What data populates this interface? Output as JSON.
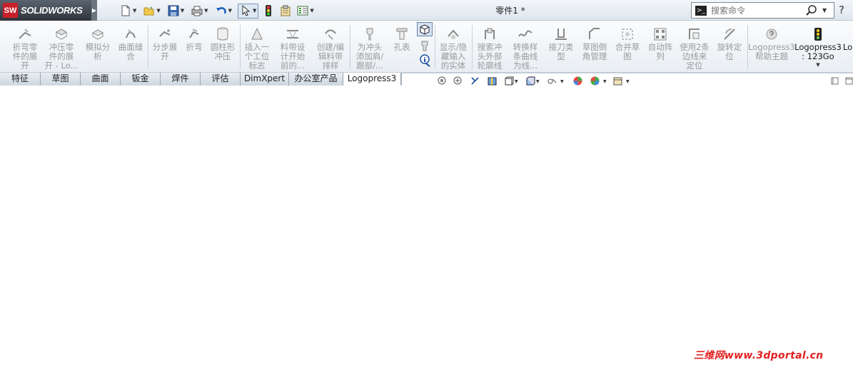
{
  "app": {
    "logo_mark": "SW",
    "logo_text": "SOLIDWORKS",
    "doc_title": "零件1 *"
  },
  "quick_access": [
    {
      "name": "new-document-icon"
    },
    {
      "name": "open-folder-icon"
    },
    {
      "name": "save-icon"
    },
    {
      "name": "print-icon"
    },
    {
      "name": "undo-icon"
    },
    {
      "name": "select-arrow-icon"
    },
    {
      "name": "rebuild-traffic-light-icon"
    },
    {
      "name": "file-properties-icon"
    },
    {
      "name": "options-icon"
    }
  ],
  "search": {
    "placeholder": "搜索命令",
    "help_glyph": "?"
  },
  "ribbon": {
    "tools": [
      {
        "label": "折弯零\n件的展\n开",
        "icon": "bend-unfold-icon"
      },
      {
        "label": "冲压零\n件的展\n开 - Lo...",
        "icon": "stamp-unfold-icon"
      },
      {
        "label": "模拟分\n析",
        "icon": "simulation-icon"
      },
      {
        "label": "曲面缝\n合",
        "icon": "surface-knit-icon"
      },
      {
        "label": "分步展\n开",
        "icon": "step-unfold-icon"
      },
      {
        "label": "折弯",
        "icon": "bend-icon"
      },
      {
        "label": "圆柱形\n冲压",
        "icon": "cylinder-stamp-icon"
      },
      {
        "label": "插入一\n个工位\n标志",
        "icon": "station-mark-icon"
      },
      {
        "label": "料带设\n计开始\n前的...",
        "icon": "strip-design-icon"
      },
      {
        "label": "创建/编\n辑料带\n排样",
        "icon": "strip-layout-icon"
      },
      {
        "label": "为冲头\n添加肩/\n跟部/...",
        "icon": "punch-shoulder-icon"
      },
      {
        "label": "孔表",
        "icon": "hole-table-icon"
      },
      {
        "label": "显示/隐\n藏输入\n的实体",
        "icon": "show-hide-body-icon"
      },
      {
        "label": "搜索冲\n头外部\n轮廓线",
        "icon": "punch-contour-icon"
      },
      {
        "label": "转换样\n条曲线\n为线...",
        "icon": "spline-convert-icon"
      },
      {
        "label": "接刀类\n型",
        "icon": "cutter-type-icon"
      },
      {
        "label": "草图倒\n角管理",
        "icon": "sketch-chamfer-icon"
      },
      {
        "label": "合并草\n图",
        "icon": "merge-sketch-icon"
      },
      {
        "label": "自动阵\n列",
        "icon": "auto-pattern-icon"
      },
      {
        "label": "使用2条\n边线来\n定位",
        "icon": "two-edge-position-icon"
      },
      {
        "label": "旋转定\n位",
        "icon": "rotate-position-icon"
      },
      {
        "label": "Logopress3\n帮助主题",
        "icon": "help-topic-icon"
      },
      {
        "label": "Logopress3\n: 123Go",
        "icon": "goto-123-icon"
      },
      {
        "label": "Lo",
        "icon": "more-tools-icon"
      }
    ]
  },
  "tabs": [
    {
      "label": "特征"
    },
    {
      "label": "草图"
    },
    {
      "label": "曲面"
    },
    {
      "label": "钣金"
    },
    {
      "label": "焊件"
    },
    {
      "label": "评估"
    },
    {
      "label": "DimXpert"
    },
    {
      "label": "办公室产品"
    },
    {
      "label": "Logopress3"
    }
  ],
  "active_tab": "Logopress3",
  "watermark": "三维网www.3dportal.cn"
}
